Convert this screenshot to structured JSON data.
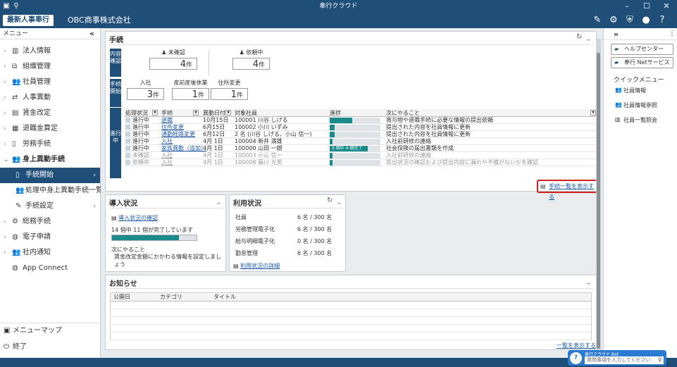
{
  "window": {
    "title": "奉行クラウド"
  },
  "header": {
    "logo": "最新人事奉行",
    "company": "OBC商事株式会社"
  },
  "sidebar": {
    "heading": "メニュー",
    "collapse": "«",
    "items": [
      {
        "label": "法人情報"
      },
      {
        "label": "組織管理"
      },
      {
        "label": "社員管理"
      },
      {
        "label": "人事異動"
      },
      {
        "label": "賃金改定"
      },
      {
        "label": "退職金算定"
      },
      {
        "label": "労務手続"
      },
      {
        "label": "身上異動手続"
      },
      {
        "label": "手続開始"
      },
      {
        "label": "処理中身上異動手続一覧"
      },
      {
        "label": "手続設定"
      },
      {
        "label": "総務手続"
      },
      {
        "label": "電子申請"
      },
      {
        "label": "社内通知"
      },
      {
        "label": "App Connect"
      }
    ],
    "menu_map": "メニューマップ",
    "exit": "終了"
  },
  "procedures": {
    "title": "手続",
    "tab_content": "内容確認",
    "tab_start": "手続開始",
    "tab_progress": "進行中",
    "unconfirmed": {
      "label": "未確認",
      "value": "4",
      "unit": "件"
    },
    "requesting": {
      "label": "依頼中",
      "value": "4",
      "unit": "件"
    },
    "joining": {
      "label": "入社",
      "value": "3",
      "unit": "件"
    },
    "maternity": {
      "label": "産前産後休業",
      "value": "1",
      "unit": "件"
    },
    "address": {
      "label": "住所変更",
      "value": "1",
      "unit": "件"
    },
    "columns": {
      "status": "処理状況",
      "proc": "手続",
      "date": "異動日付",
      "emp": "対象社員",
      "progress": "進捗",
      "next": "次にやること"
    },
    "rows": [
      {
        "status": "進行中",
        "proc": "退職",
        "date": "10月15日",
        "emp": "100001  川谷  しげる",
        "pct": 0.45,
        "ptxt": "",
        "next": "賞与物や退職手続に必要な情報の提出依頼",
        "muted": false
      },
      {
        "status": "進行中",
        "proc": "住所変更",
        "date": "6月15日",
        "emp": "100002  小川  いずみ",
        "pct": 0.1,
        "ptxt": "",
        "next": "提出された内容を社員情報に更新",
        "muted": false
      },
      {
        "status": "進行中",
        "proc": "通勤経路変更",
        "date": "6月12日",
        "emp": "2 名 (川谷  しげる、小山  信一)",
        "pct": 0.1,
        "ptxt": "",
        "next": "提出された内容を社員情報に更新",
        "muted": false
      },
      {
        "status": "進行中",
        "proc": "入社",
        "date": "4月 1日",
        "emp": "100004  新井  満雄",
        "pct": 0.05,
        "ptxt": "",
        "next": "入社前研修の連絡",
        "muted": false
      },
      {
        "status": "進行中",
        "proc": "家族異動（追加）",
        "date": "4月 1日",
        "emp": "100000  山田  一朗",
        "pct": 0.75,
        "ptxt": "3 個中 4 個完了",
        "next": "社会保険の届出書類を作成",
        "muted": false
      },
      {
        "status": "未確認",
        "proc": "入社",
        "date": "4月 1日",
        "emp": "100003  小山  信一",
        "pct": 0.05,
        "ptxt": "",
        "next": "入社前研修の連絡",
        "muted": true
      },
      {
        "status": "依頼中",
        "proc": "入社",
        "date": "4月 1日",
        "emp": "100008  藤川  光男",
        "pct": 0.05,
        "ptxt": "",
        "next": "提出状況の確認および提出内容に漏れや不備がないかを確認",
        "muted": true
      }
    ],
    "show_all": "手続一覧を表示する"
  },
  "intro": {
    "title": "導入状況",
    "link": "導入状況の確認",
    "progress_text": "14 個中 11 個が完了しています",
    "progress": 0.79,
    "next_label": "次にやること",
    "next_text": "賃金改定金額にかかわる情報を設定しましょう"
  },
  "usage": {
    "title": "利用状況",
    "rows": [
      {
        "label": "社員",
        "value": "6 名 / 300 名"
      },
      {
        "label": "労務管理電子化",
        "value": "6 名 / 300 名"
      },
      {
        "label": "給与明細電子化",
        "value": "0 名 / 300 名"
      },
      {
        "label": "勤怠管理",
        "value": "6 名 / 300 名"
      }
    ],
    "link": "利用状況の詳細"
  },
  "news": {
    "title": "お知らせ",
    "columns": {
      "date": "公開日",
      "category": "カテゴリ",
      "title": "タイトル"
    },
    "show_all": "一覧を表示する"
  },
  "right": {
    "expand": "»",
    "help": "ヘルプセンター",
    "net": "奉行 Netサービス",
    "quick_title": "クイックメニュー",
    "quick": [
      {
        "label": "社員情報"
      },
      {
        "label": "社員情報参照"
      },
      {
        "label": "社員一覧照会"
      }
    ]
  },
  "bot": {
    "title": "奉行クラウド Bot",
    "placeholder": "質問事項を入力してください"
  }
}
